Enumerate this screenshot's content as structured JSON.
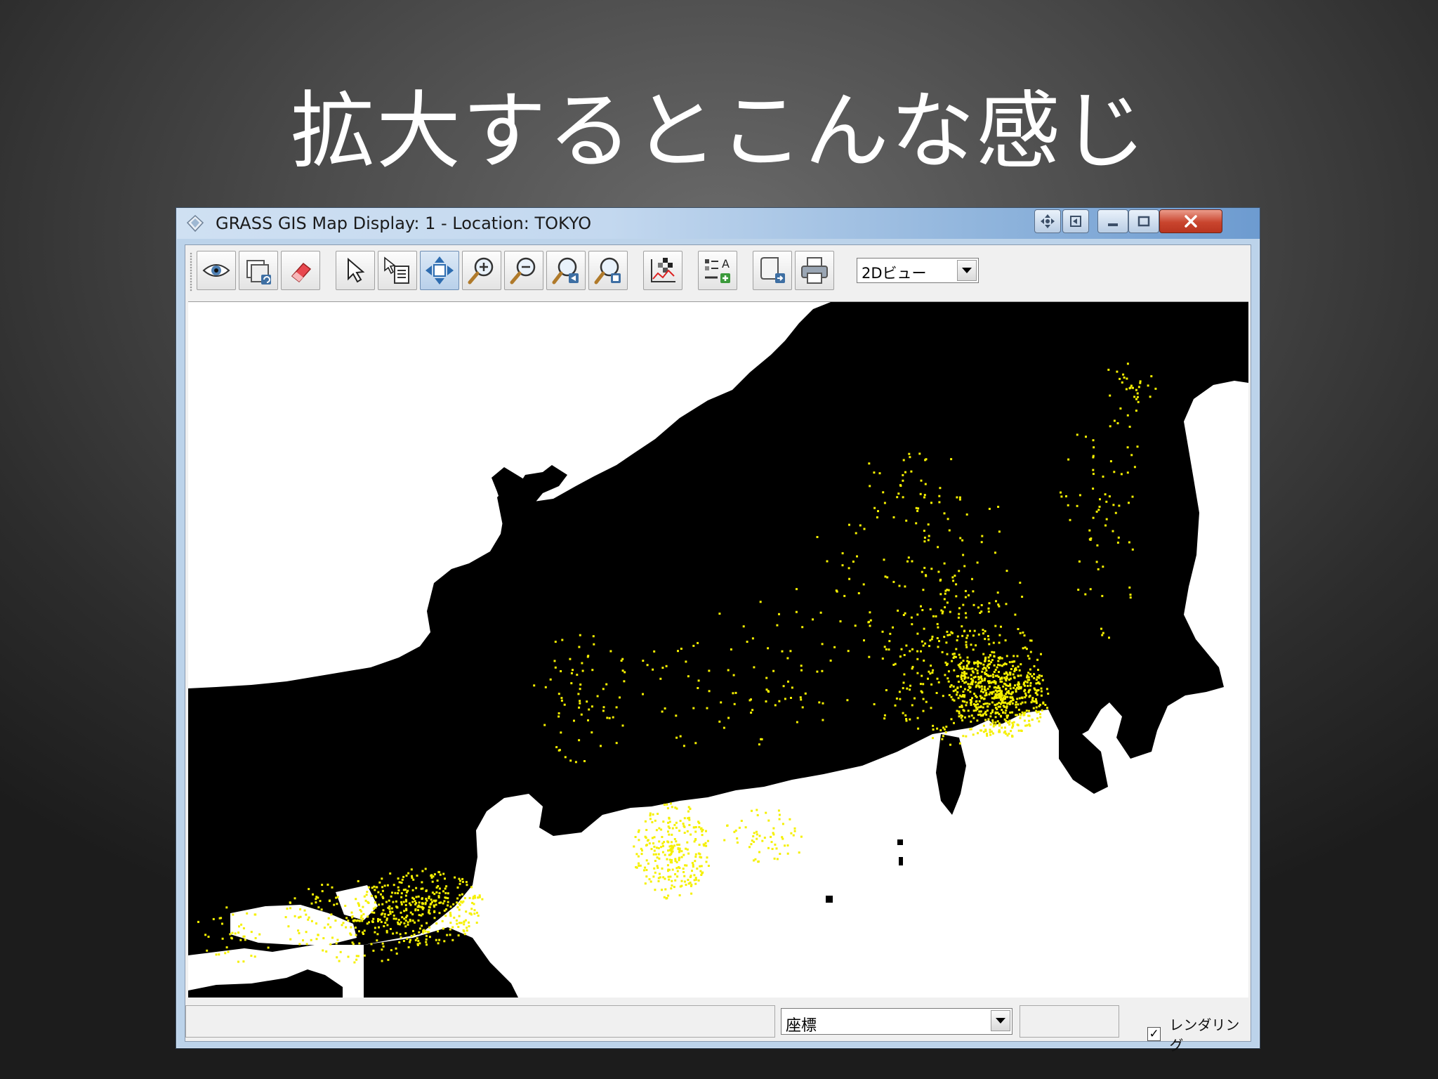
{
  "slide": {
    "title": "拡大するとこんな感じ"
  },
  "window": {
    "title": "GRASS GIS Map Display: 1 - Location: TOKYO"
  },
  "toolbar": {
    "tools": [
      {
        "name": "display-map",
        "icon": "eye-icon"
      },
      {
        "name": "render-map",
        "icon": "layer-refresh-icon"
      },
      {
        "name": "erase-display",
        "icon": "eraser-icon"
      },
      {
        "name": "pointer",
        "icon": "arrow-pointer-icon"
      },
      {
        "name": "query",
        "icon": "query-list-icon"
      },
      {
        "name": "pan",
        "icon": "pan-arrows-icon",
        "active": true
      },
      {
        "name": "zoom-in",
        "icon": "zoom-in-icon"
      },
      {
        "name": "zoom-out",
        "icon": "zoom-out-icon"
      },
      {
        "name": "zoom-back",
        "icon": "zoom-back-icon"
      },
      {
        "name": "zoom-options",
        "icon": "zoom-menu-icon"
      },
      {
        "name": "analyze",
        "icon": "analyze-chart-icon"
      },
      {
        "name": "add-overlay",
        "icon": "overlay-add-icon"
      },
      {
        "name": "save-file",
        "icon": "save-map-icon"
      },
      {
        "name": "print",
        "icon": "printer-icon"
      }
    ],
    "view_mode": "2Dビュー"
  },
  "statusbar": {
    "mode": "座標",
    "render_checked": true,
    "render_check_glyph": "✓",
    "render_label": "レンダリング"
  },
  "colors": {
    "land": "#000000",
    "sea": "#ffffff",
    "points": "#f5f000",
    "close_button": "#c9452e"
  }
}
